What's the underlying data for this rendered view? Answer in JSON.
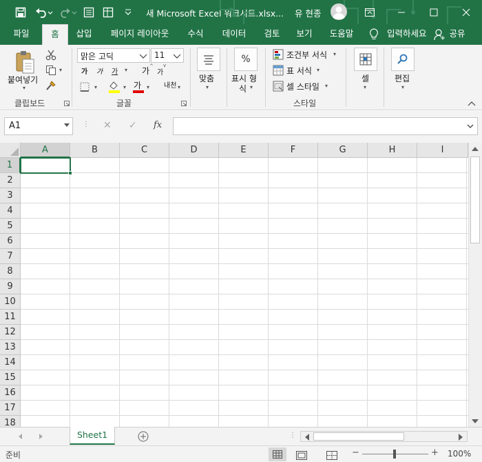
{
  "titlebar": {
    "title": "새 Microsoft Excel 워크시트.xlsx...",
    "user": "유 현종",
    "save_icon": "save-icon",
    "undo_icon": "undo-icon",
    "redo_icon": "redo-icon",
    "form_icon": "form-icon",
    "table_icon": "table-icon",
    "customize_icon": "customize-quick-access-icon"
  },
  "tabs": [
    {
      "label": "파일"
    },
    {
      "label": "홈"
    },
    {
      "label": "삽입"
    },
    {
      "label": "페이지 레이아웃"
    },
    {
      "label": "수식"
    },
    {
      "label": "데이터"
    },
    {
      "label": "검토"
    },
    {
      "label": "보기"
    },
    {
      "label": "도움말"
    }
  ],
  "tellme": "입력하세요",
  "share": "공유",
  "ribbon": {
    "clipboard": {
      "paste": "붙여넣기",
      "label": "클립보드"
    },
    "font": {
      "name": "맑은 고딕",
      "size": "11",
      "label": "글꼴",
      "grow": "가",
      "shrink": "가",
      "bold": "가",
      "italic": "가",
      "underline": "가",
      "font_color": "가",
      "phonetic": "가",
      "phonetic_sub": "내천"
    },
    "alignment": {
      "label": "맞춤"
    },
    "number": {
      "label1": "표시 형",
      "label2": "식",
      "icon": "%"
    },
    "styles": {
      "conditional": "조건부 서식",
      "table": "표 서식",
      "cell_style": "셀 스타일",
      "label": "스타일"
    },
    "cells": {
      "label": "셀"
    },
    "editing": {
      "label": "편집"
    }
  },
  "formula_bar": {
    "name_box": "A1",
    "cancel": "✕",
    "enter": "✓",
    "fx": "fx",
    "value": ""
  },
  "grid": {
    "columns": [
      "A",
      "B",
      "C",
      "D",
      "E",
      "F",
      "G",
      "H",
      "I"
    ],
    "rows": [
      "1",
      "2",
      "3",
      "4",
      "5",
      "6",
      "7",
      "8",
      "9",
      "10",
      "11",
      "12",
      "13",
      "14",
      "15",
      "16",
      "17",
      "18"
    ],
    "active_cell": "A1"
  },
  "sheets": [
    {
      "name": "Sheet1"
    }
  ],
  "status": {
    "ready": "준비",
    "zoom": "100%"
  },
  "colors": {
    "brand": "#217346",
    "ribbon": "#f3f3f3"
  }
}
